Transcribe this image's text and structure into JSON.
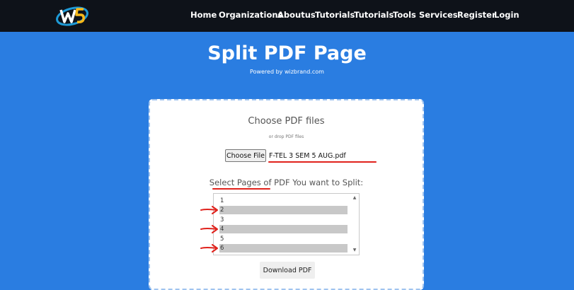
{
  "nav": {
    "items": [
      "Home",
      "Organizations",
      "Aboutus",
      "Tutorials",
      "Tutorials",
      "Tools",
      "Services",
      "Register",
      "Login"
    ]
  },
  "hero": {
    "title": "Split PDF Page",
    "subtitle": "Powered by wizbrand.com"
  },
  "upload": {
    "title": "Choose PDF files",
    "hint": "or drop PDF files",
    "choose_button": "Choose File",
    "file_name": "F-TEL 3 SEM 5 AUG.pdf"
  },
  "pages": {
    "label": "Select Pages of PDF You want to Split:",
    "items": [
      {
        "label": "1",
        "selected": false
      },
      {
        "label": "2",
        "selected": true
      },
      {
        "label": "3",
        "selected": false
      },
      {
        "label": "4",
        "selected": true
      },
      {
        "label": "5",
        "selected": false
      },
      {
        "label": "6",
        "selected": true
      }
    ]
  },
  "download_button": "Download PDF",
  "colors": {
    "background": "#2a7de1",
    "navbar": "#0e1219",
    "annotation": "#e0221c",
    "selected_row": "#c8c8c8"
  }
}
